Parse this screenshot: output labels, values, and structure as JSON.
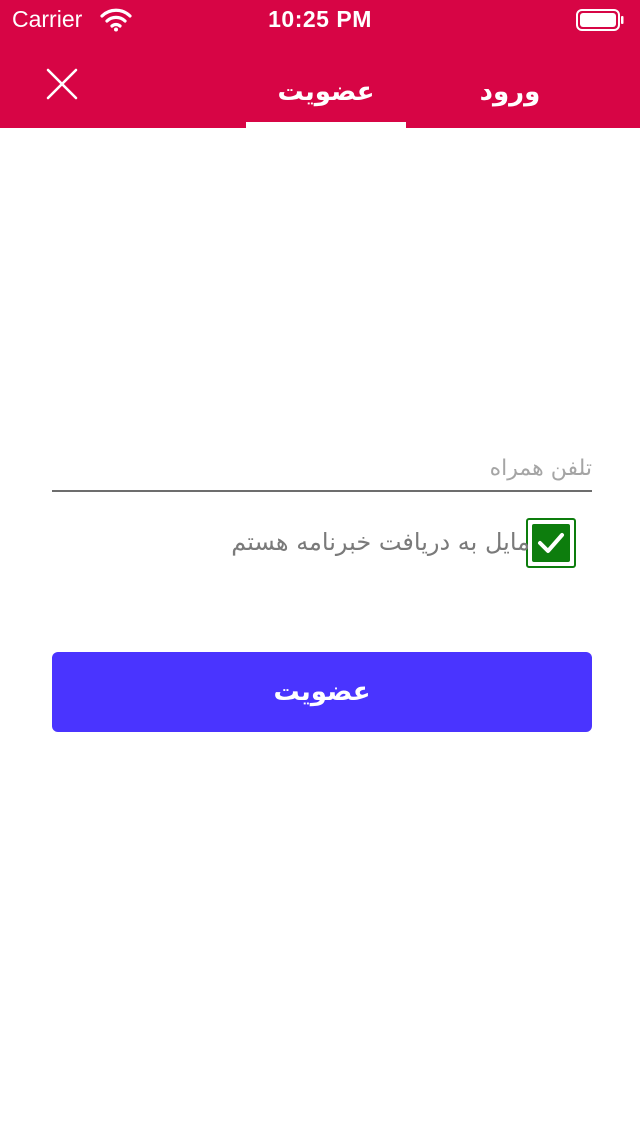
{
  "status_bar": {
    "carrier": "Carrier",
    "time": "10:25 PM",
    "icons": [
      "wifi-icon",
      "battery-icon"
    ]
  },
  "header": {
    "close_icon": "close-icon",
    "tabs": [
      {
        "label": "عضویت",
        "active": true
      },
      {
        "label": "ورود",
        "active": false
      }
    ]
  },
  "form": {
    "phone_placeholder": "تلفن همراه",
    "phone_value": "",
    "newsletter_label": "مایل به دریافت خبرنامه هستم",
    "newsletter_checked": true,
    "submit_label": "عضویت"
  },
  "colors": {
    "header_bg": "#d70545",
    "button_bg": "#4a34ff",
    "checkbox_green": "#0d7d0d"
  }
}
